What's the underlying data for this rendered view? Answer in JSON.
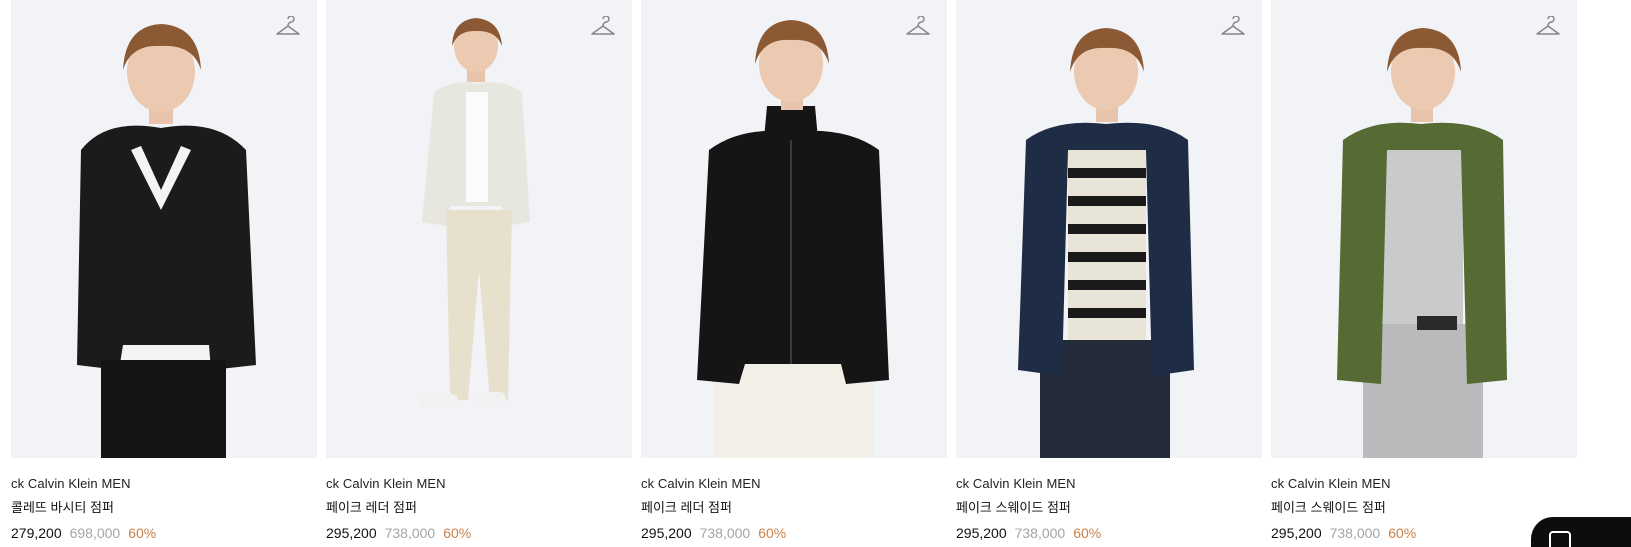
{
  "products": [
    {
      "brand": "ck Calvin Klein MEN",
      "name": "콜레뜨 바시티 점퍼",
      "sale_price": "279,200",
      "original_price": "698,000",
      "discount": "60%",
      "jacket_color": "#1b1b1b",
      "inner_color": "#f4f4f4",
      "pants_color": "#141414",
      "image": "model-black-varsity-jacket"
    },
    {
      "brand": "ck Calvin Klein MEN",
      "name": "페이크 레더 점퍼",
      "sale_price": "295,200",
      "original_price": "738,000",
      "discount": "60%",
      "jacket_color": "#e8e7df",
      "inner_color": "#fbfbfb",
      "pants_color": "#e6e0cc",
      "image": "model-cream-leather-jacket"
    },
    {
      "brand": "ck Calvin Klein MEN",
      "name": "페이크 레더 점퍼",
      "sale_price": "295,200",
      "original_price": "738,000",
      "discount": "60%",
      "jacket_color": "#151515",
      "inner_color": "#151515",
      "pants_color": "#f2efe6",
      "image": "model-black-leather-jacket"
    },
    {
      "brand": "ck Calvin Klein MEN",
      "name": "페이크 스웨이드 점퍼",
      "sale_price": "295,200",
      "original_price": "738,000",
      "discount": "60%",
      "jacket_color": "#1e2c45",
      "inner_color": "#e9e4d8",
      "pants_color": "#232a3a",
      "image": "model-navy-suede-jacket"
    },
    {
      "brand": "ck Calvin Klein MEN",
      "name": "페이크 스웨이드 점퍼",
      "sale_price": "295,200",
      "original_price": "738,000",
      "discount": "60%",
      "jacket_color": "#566a34",
      "inner_color": "#c9cbca",
      "pants_color": "#b8babb",
      "image": "model-olive-suede-jacket"
    }
  ],
  "icons": {
    "wishlist": "hanger-icon",
    "floating_button": "square-icon"
  },
  "colors": {
    "discount": "#c9814a",
    "original_price": "#a5a5a5",
    "photo_bg": "#f2f3f6"
  }
}
